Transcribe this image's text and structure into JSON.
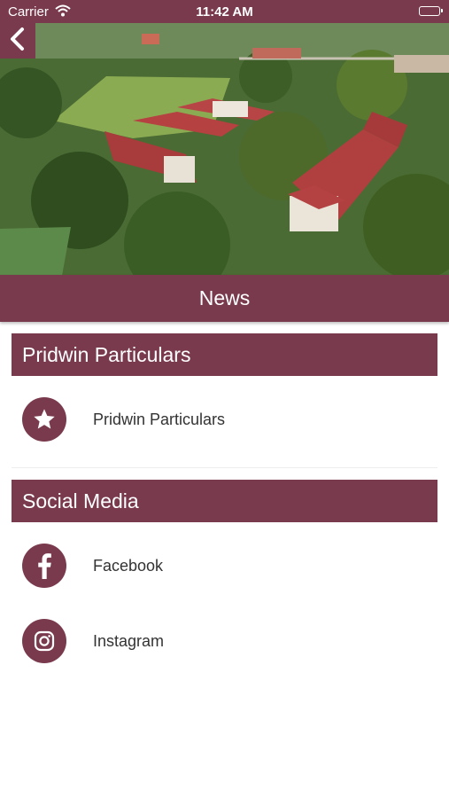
{
  "status_bar": {
    "carrier": "Carrier",
    "time": "11:42 AM",
    "wifi_icon": "wifi-icon",
    "battery_icon": "battery-icon"
  },
  "header": {
    "back_icon": "chevron-left-icon",
    "title": "News"
  },
  "sections": [
    {
      "title": "Pridwin Particulars",
      "items": [
        {
          "label": "Pridwin Particulars",
          "icon": "star-icon"
        }
      ]
    },
    {
      "title": "Social Media",
      "items": [
        {
          "label": "Facebook",
          "icon": "facebook-icon"
        },
        {
          "label": "Instagram",
          "icon": "instagram-icon"
        }
      ]
    }
  ],
  "colors": {
    "accent": "#7a3a4e",
    "background": "#ffffff",
    "text": "#333333"
  }
}
